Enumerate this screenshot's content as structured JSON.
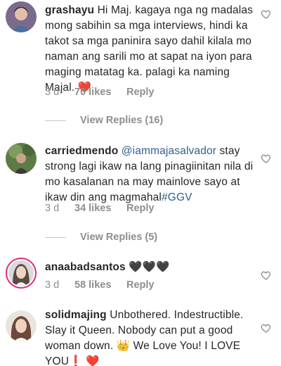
{
  "comments": [
    {
      "username": "grashayu",
      "text": "Hi Maj. kagaya nga ng madalas mong sabihin sa mga interviews, hindi ka takot sa mga paninira sayo dahil kilala mo naman ang sarili mo at sapat na iyon para maging matatag ka. palagi ka naming Majal.",
      "emoji": "❤️",
      "time": "3 d",
      "likes": "70 likes",
      "reply": "Reply",
      "view_replies": "View Replies (16)"
    },
    {
      "username": "carriedmendo",
      "mention": "@iammajasalvador",
      "text": " stay strong lagi ikaw na lang pinagiinitan nila di mo kasalanan na may mainlove sayo at ikaw din ang magmahal",
      "hashtag": "#GGV",
      "time": "3 d",
      "likes": "34 likes",
      "reply": "Reply",
      "view_replies": "View Replies (5)"
    },
    {
      "username": "anaabadsantos",
      "text": "🖤🖤🖤",
      "time": "3 d",
      "likes": "58 likes",
      "reply": "Reply"
    },
    {
      "username": "solidmajing",
      "text": "Unbothered. Indestructible. Slay it Queen. Nobody can put a good woman down. 👑 We Love You! I LOVE YOU❗",
      "emoji": "❤️"
    }
  ],
  "icons": {
    "like": "heart-outline-icon"
  },
  "colors": {
    "meta": "#8e8e8e",
    "link": "#2f5f8f",
    "heart": "#ed4956"
  }
}
